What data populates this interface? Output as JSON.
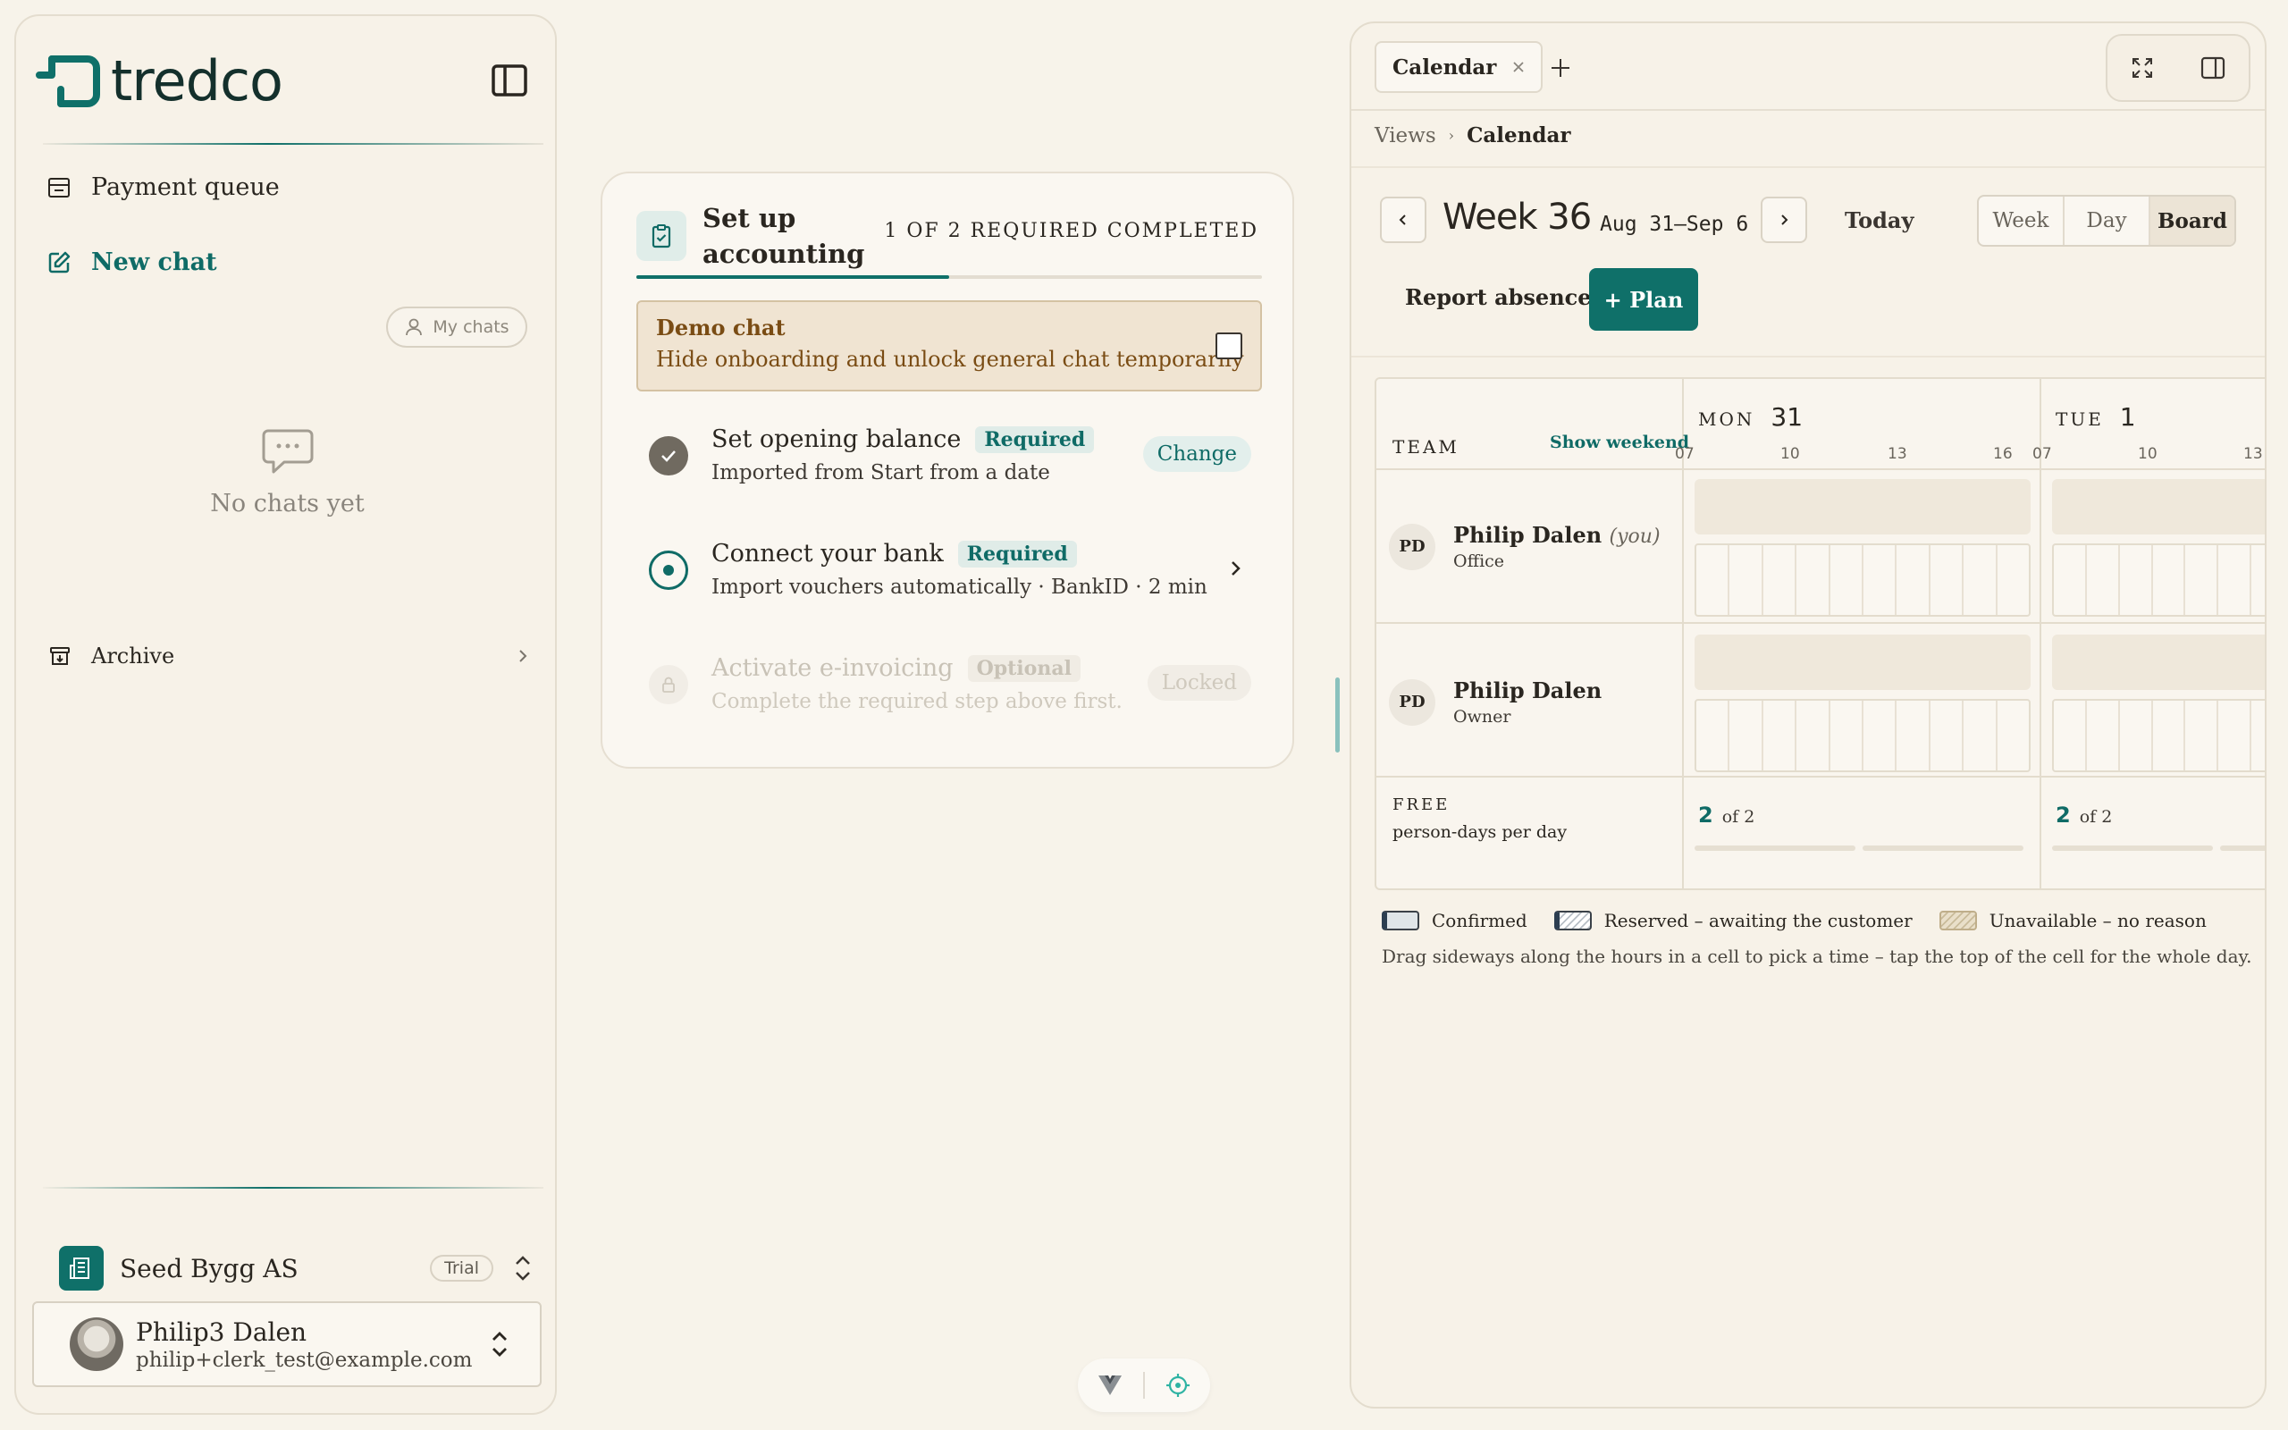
{
  "colors": {
    "accent": "#0f7069",
    "background": "#f7f3ea",
    "warning_bg": "#f0e4d2",
    "warning_text": "#7a4c14"
  },
  "sidebar": {
    "brand": "tredco",
    "nav": {
      "payment_queue": "Payment queue",
      "new_chat": "New chat",
      "my_chats": "My chats",
      "empty_text": "No chats yet",
      "archive": "Archive"
    },
    "org": {
      "name": "Seed Bygg AS",
      "badge": "Trial"
    },
    "user": {
      "name": "Philip3 Dalen",
      "email": "philip+clerk_test@example.com"
    }
  },
  "onboarding": {
    "title": "Set up accounting",
    "progress_text": "1 OF 2 REQUIRED COMPLETED",
    "progress_fraction": 0.5,
    "demo": {
      "title": "Demo chat",
      "description": "Hide onboarding and unlock general chat temporarily",
      "checked": false
    },
    "steps": [
      {
        "title": "Set opening balance",
        "badge": "Required",
        "description": "Imported from Start from a date",
        "action": "Change",
        "state": "done"
      },
      {
        "title": "Connect your bank",
        "badge": "Required",
        "description": "Import vouchers automatically · BankID · 2 min",
        "state": "current"
      },
      {
        "title": "Activate e-invoicing",
        "badge": "Optional",
        "description": "Complete the required step above first.",
        "action": "Locked",
        "state": "locked"
      }
    ]
  },
  "calendar": {
    "tab_label": "Calendar",
    "breadcrumb": {
      "parent": "Views",
      "current": "Calendar"
    },
    "week_title": "Week 36",
    "week_range": "Aug 31–Sep 6",
    "today": "Today",
    "views": [
      "Week",
      "Day",
      "Board"
    ],
    "active_view": "Board",
    "report_absence": "Report absence",
    "plan_button": "+ Plan",
    "grid": {
      "team_label": "TEAM",
      "show_weekend": "Show weekend",
      "days": [
        {
          "name": "MON",
          "num": "31",
          "ticks": [
            "07",
            "10",
            "13",
            "16"
          ],
          "free_count": "2",
          "free_of": "of 2"
        },
        {
          "name": "TUE",
          "num": "1",
          "ticks": [
            "07",
            "10",
            "13"
          ],
          "free_count": "2",
          "free_of": "of 2"
        }
      ],
      "people": [
        {
          "initials": "PD",
          "name": "Philip Dalen",
          "you": "(you)",
          "role": "Office"
        },
        {
          "initials": "PD",
          "name": "Philip Dalen",
          "role": "Owner"
        }
      ],
      "free_label": "FREE",
      "free_sub": "person-days per day"
    },
    "legend": {
      "confirmed": "Confirmed",
      "reserved": "Reserved – awaiting the customer",
      "unavailable": "Unavailable – no reason"
    },
    "hint": "Drag sideways along the hours in a cell to pick a time – tap the top of the cell for the whole day."
  }
}
